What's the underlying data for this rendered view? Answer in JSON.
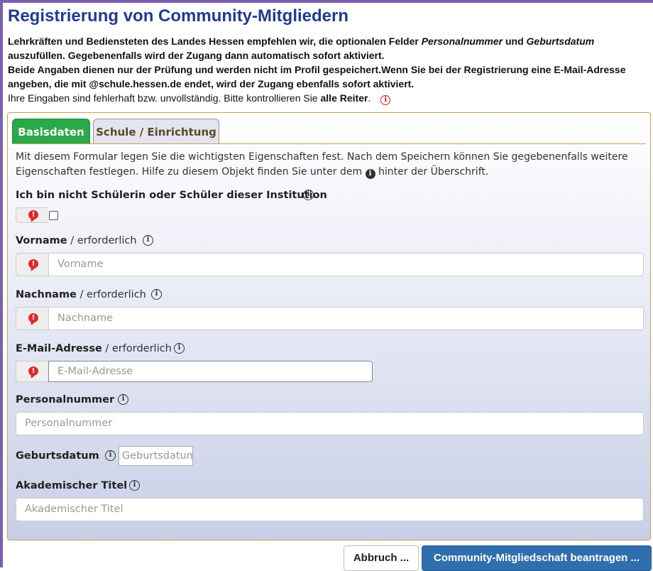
{
  "page": {
    "title": "Registrierung von Community-Mitgliedern"
  },
  "intro": {
    "line1_a": "Lehrkräften und Bediensteten des Landes Hessen empfehlen wir, die optionalen Felder ",
    "line1_field1": "Personalnummer",
    "line1_and": " und ",
    "line1_field2": "Geburtsdatum",
    "line1_b": " auszufüllen. Gegebenenfalls wird der Zugang dann automatisch sofort aktiviert.",
    "line2": "Beide Angaben dienen nur der Prüfung und werden nicht im Profil gespeichert.Wenn Sie bei der Registrierung eine E-Mail-Adresse angeben, die mit @schule.hessen.de endet, wird der Zugang ebenfalls sofort aktiviert.",
    "error_a": "Ihre Eingaben sind fehlerhaft bzw. unvollständig. Bitte kontrollieren Sie ",
    "error_strong": "alle Reiter",
    "error_b": ".",
    "error_icon": "i"
  },
  "tabs": [
    {
      "label": "Basisdaten",
      "active": true
    },
    {
      "label": "Schule / Einrichtung",
      "active": false
    }
  ],
  "description": {
    "text_a": "Mit diesem Formular legen Sie die wichtigsten Eigenschaften fest. Nach dem Speichern können Sie gegebenenfalls weitere Eigenschaften festlegen. Hilfe zu diesem Objekt finden Sie unter dem ",
    "text_b": " hinter der Überschrift.",
    "icon": "i"
  },
  "fields": {
    "not_student": {
      "label": "Ich bin nicht Schülerin oder Schüler dieser Institution",
      "checked": false
    },
    "vorname": {
      "label": "Vorname",
      "req": " / erforderlich",
      "placeholder": "Vorname"
    },
    "nachname": {
      "label": "Nachname",
      "req": " / erforderlich",
      "placeholder": "Nachname"
    },
    "email": {
      "label": "E-Mail-Adresse",
      "req": " / erforderlich",
      "placeholder": "E-Mail-Adresse"
    },
    "personalnummer": {
      "label": "Personalnummer",
      "placeholder": "Personalnummer"
    },
    "geburtsdatum": {
      "label": "Geburtsdatum",
      "placeholder": "Geburtsdatum"
    },
    "titel": {
      "label": "Akademischer Titel",
      "placeholder": "Akademischer Titel"
    }
  },
  "icons": {
    "info": "i",
    "required_marker": "!"
  },
  "buttons": {
    "cancel": "Abbruch ...",
    "submit": "Community-Mitgliedschaft beantragen ..."
  },
  "colors": {
    "title": "#1f3c93",
    "active_tab": "#2aa84a",
    "submit": "#2f6fad",
    "error": "#e5262d",
    "frame": "#7b5fb0"
  }
}
